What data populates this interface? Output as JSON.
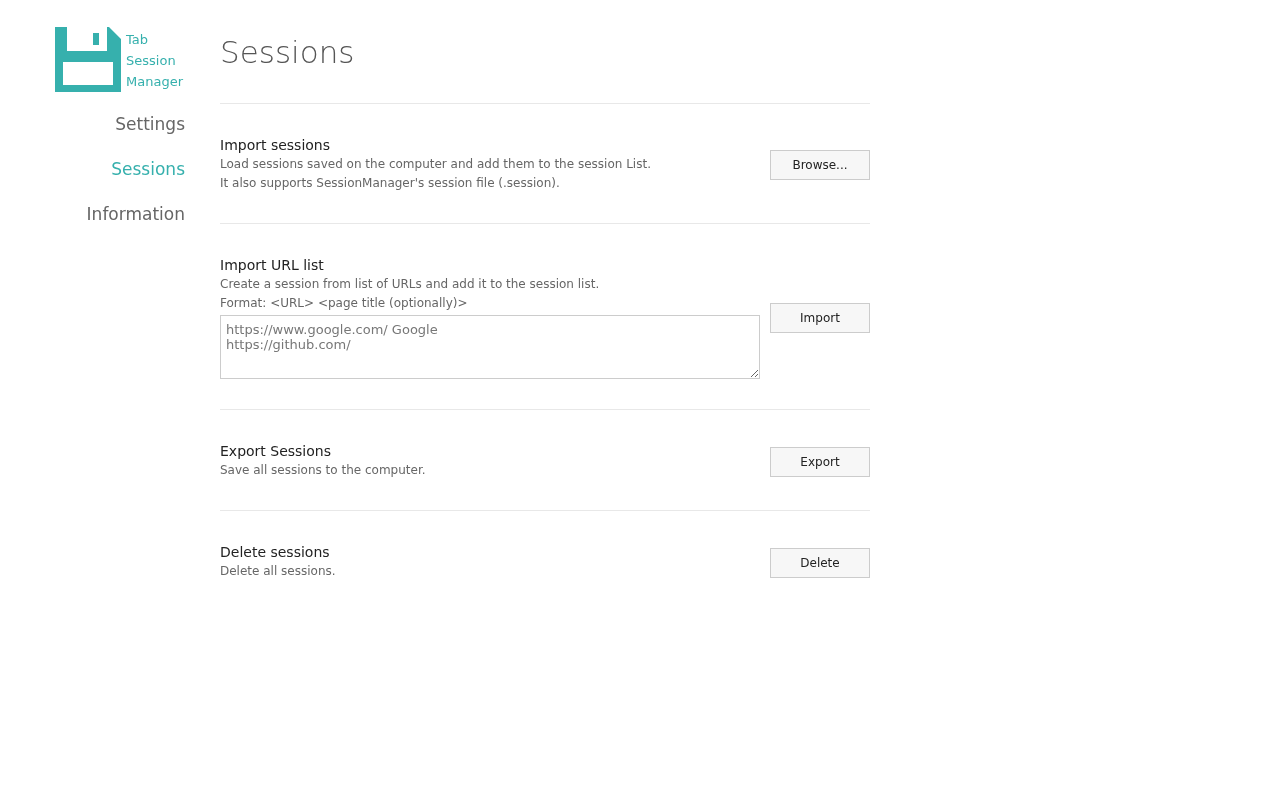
{
  "logo": {
    "lines": [
      "Tab",
      "Session",
      "Manager"
    ]
  },
  "nav": [
    {
      "label": "Settings",
      "selected": false
    },
    {
      "label": "Sessions",
      "selected": true
    },
    {
      "label": "Information",
      "selected": false
    }
  ],
  "page_title": "Sessions",
  "sections": [
    {
      "kind": "button",
      "title": "Import sessions",
      "descriptions": [
        "Load sessions saved on the computer and add them to the session List.",
        "It also supports SessionManager's session file (.session)."
      ],
      "button": "Browse..."
    },
    {
      "kind": "textarea",
      "title": "Import URL list",
      "descriptions": [
        "Create a session from list of URLs and add it to the session list.",
        "Format: <URL> <page title (optionally)>"
      ],
      "placeholder": "https://www.google.com/ Google\nhttps://github.com/",
      "button": "Import"
    },
    {
      "kind": "button",
      "title": "Export Sessions",
      "descriptions": [
        "Save all sessions to the computer."
      ],
      "button": "Export"
    },
    {
      "kind": "button",
      "title": "Delete sessions",
      "descriptions": [
        "Delete all sessions."
      ],
      "button": "Delete"
    }
  ]
}
